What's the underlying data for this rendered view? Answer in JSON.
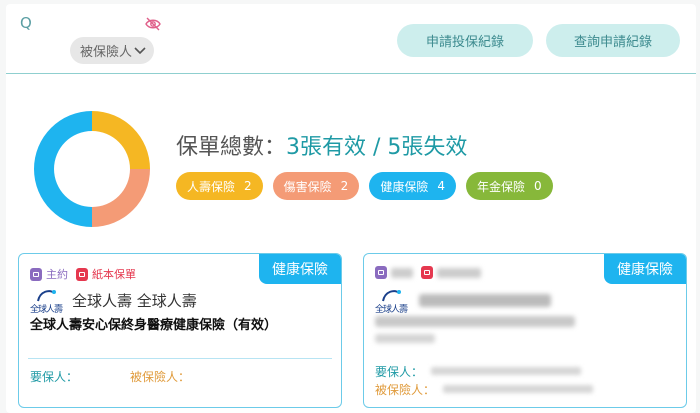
{
  "search": {
    "icon": "Q",
    "value": ""
  },
  "insured_filter": {
    "label": "被保險人"
  },
  "buttons": {
    "apply": "申請投保紀錄",
    "query": "查詢申請紀錄"
  },
  "summary": {
    "prefix": "保單總數：",
    "active": "3張有效",
    "sep": " / ",
    "inactive": "5張失效"
  },
  "donut_chart": {
    "type": "pie",
    "segments": [
      {
        "name": "人壽保險",
        "value": 2,
        "color": "#f5b723"
      },
      {
        "name": "傷害保險",
        "value": 2,
        "color": "#f49b76"
      },
      {
        "name": "健康保險",
        "value": 4,
        "color": "#1eb4ef"
      },
      {
        "name": "年金保險",
        "value": 0,
        "color": "#87b83a"
      }
    ]
  },
  "tags": [
    {
      "label": "人壽保險",
      "count": "2"
    },
    {
      "label": "傷害保險",
      "count": "2"
    },
    {
      "label": "健康保險",
      "count": "4"
    },
    {
      "label": "年金保險",
      "count": "0"
    }
  ],
  "cards": [
    {
      "type": "健康保險",
      "badge_main": "主約",
      "badge_paper": "紙本保單",
      "logo_text": "全球人壽",
      "company": "全球人壽 全球人壽",
      "product": "全球人壽安心保終身醫療健康保險（有效）",
      "holder_label": "要保人：",
      "insured_label": "被保險人："
    },
    {
      "type": "健康保險",
      "logo_text": "全球人壽",
      "holder_label": "要保人：",
      "insured_label": "被保險人："
    }
  ]
}
